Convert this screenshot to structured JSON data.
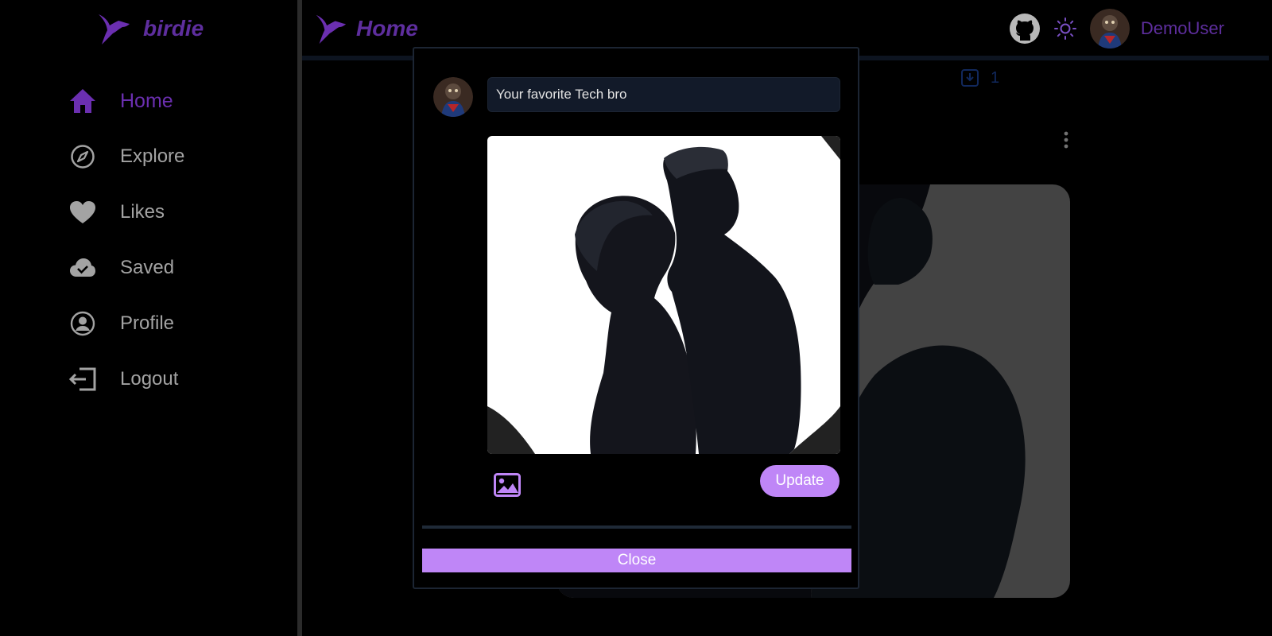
{
  "app": {
    "brand_name": "birdie",
    "brand_icon": "hummingbird-icon",
    "accent_color": "#5e2e9e",
    "button_color": "#bf86f7"
  },
  "sidebar": {
    "items": [
      {
        "label": "Home",
        "icon": "home-icon",
        "active": true
      },
      {
        "label": "Explore",
        "icon": "compass-icon",
        "active": false
      },
      {
        "label": "Likes",
        "icon": "heart-icon",
        "active": false
      },
      {
        "label": "Saved",
        "icon": "cloud-check-icon",
        "active": false
      },
      {
        "label": "Profile",
        "icon": "user-circle-icon",
        "active": false
      },
      {
        "label": "Logout",
        "icon": "logout-icon",
        "active": false
      }
    ]
  },
  "header": {
    "title": "Home",
    "icons": [
      "github-icon",
      "sun-icon"
    ],
    "user_name": "DemoUser"
  },
  "feed": {
    "tab_count": "1"
  },
  "modal": {
    "caption_value": "Your favorite Tech bro",
    "update_label": "Update",
    "close_label": "Close"
  }
}
